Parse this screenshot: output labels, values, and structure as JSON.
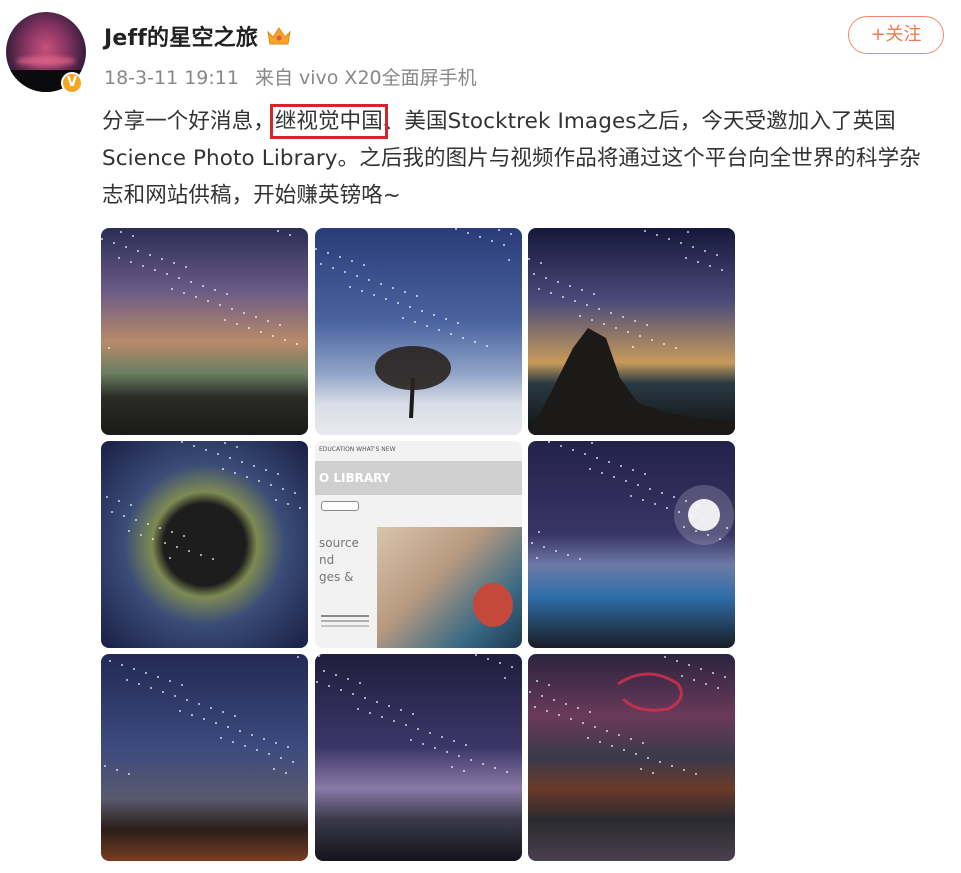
{
  "user": {
    "name": "Jeff的星空之旅",
    "verified_badge": "V",
    "timestamp": "18-3-11 19:11",
    "source": "来自 vivo X20全面屏手机"
  },
  "follow_button": {
    "label": "+关注"
  },
  "post": {
    "text_before": "分享一个好消息，",
    "highlighted": "继视觉中国",
    "text_after": "、美国Stocktrek Images之后，今天受邀加入了英国Science Photo Library。之后我的图片与视频作品将通过这个平台向全世界的科学杂志和网站供稿，开始赚英镑咯~"
  },
  "screenshot_tile": {
    "nav_text": "EDUCATION  WHAT'S NEW",
    "library_text": "O LIBRARY",
    "side_text": "source\nnd\nges &"
  },
  "colors": {
    "accent": "#ee7a4e",
    "highlight_box": "#d0272d",
    "badge": "#f5a623"
  },
  "icons": [
    "verified-badge-icon",
    "crown-icon"
  ]
}
